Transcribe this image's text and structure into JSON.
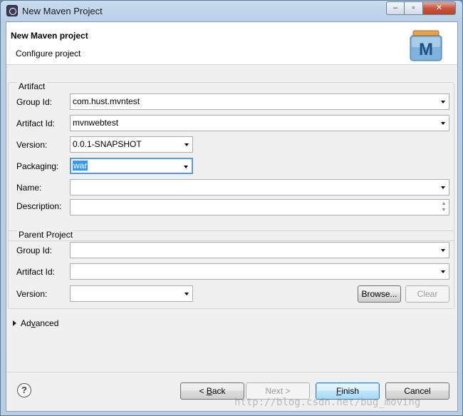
{
  "window": {
    "title": "New Maven Project",
    "controls": {
      "minimize": "–",
      "maximize": "▫",
      "close": "✕"
    }
  },
  "header": {
    "title": "New Maven project",
    "subtitle": "Configure project",
    "logo_letter": "M"
  },
  "artifact": {
    "group_title": "Artifact",
    "group_id_label": "Group Id:",
    "group_id_value": "com.hust.mvntest",
    "artifact_id_label": "Artifact Id:",
    "artifact_id_value": "mvnwebtest",
    "version_label": "Version:",
    "version_value": "0.0.1-SNAPSHOT",
    "packaging_label": "Packaging:",
    "packaging_value": "war",
    "name_label": "Name:",
    "name_value": "",
    "description_label": "Description:",
    "description_value": ""
  },
  "parent": {
    "group_title": "Parent Project",
    "group_id_label": "Group Id:",
    "group_id_value": "",
    "artifact_id_label": "Artifact Id:",
    "artifact_id_value": "",
    "version_label": "Version:",
    "version_value": "",
    "browse_label": "Browse...",
    "clear_label": "Clear"
  },
  "advanced": {
    "label_prefix": "Ad",
    "label_mnemonic": "v",
    "label_suffix": "anced"
  },
  "buttons": {
    "help": "?",
    "back_prefix": "< ",
    "back_mnemonic": "B",
    "back_suffix": "ack",
    "next": "Next >",
    "finish_mnemonic": "F",
    "finish_suffix": "inish",
    "cancel": "Cancel"
  },
  "watermark": "http://blog.csdn.net/bug_moving",
  "colors": {
    "selection": "#3399ff",
    "focus_border": "#5a9bd5",
    "default_button_border": "#3c7fb1"
  }
}
